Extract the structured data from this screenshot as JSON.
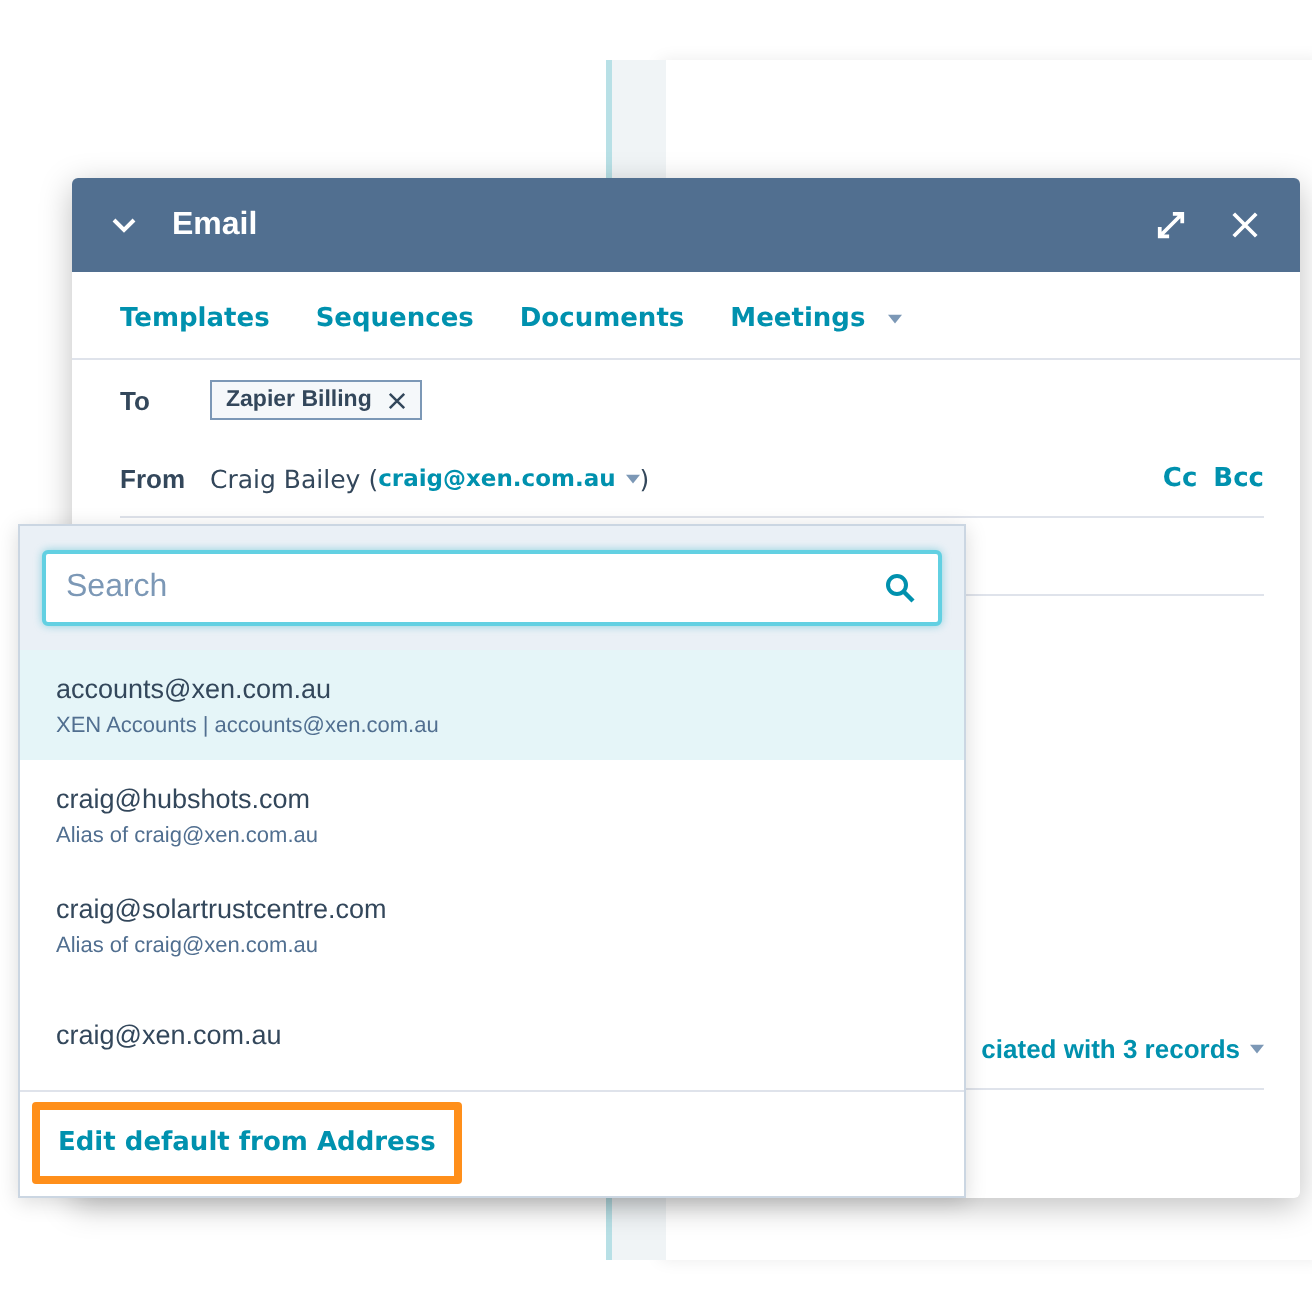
{
  "email": {
    "title": "Email",
    "tabs": [
      {
        "label": "Templates",
        "kind": "link"
      },
      {
        "label": "Sequences",
        "kind": "link"
      },
      {
        "label": "Documents",
        "kind": "link"
      },
      {
        "label": "Meetings",
        "kind": "menu"
      }
    ],
    "to": {
      "label": "To",
      "recipients": [
        {
          "name": "Zapier Billing"
        }
      ]
    },
    "from": {
      "label": "From",
      "name": "Craig Bailey",
      "open": "(",
      "address": "craig@xen.com.au",
      "close": ")"
    },
    "cc": "Cc",
    "bcc": "Bcc",
    "association": "ciated with 3 records"
  },
  "from_menu": {
    "search": {
      "placeholder": "Search"
    },
    "options": [
      {
        "address": "accounts@xen.com.au",
        "detail": "XEN Accounts | accounts@xen.com.au",
        "selected": true
      },
      {
        "address": "craig@hubshots.com",
        "detail": "Alias of craig@xen.com.au",
        "selected": false
      },
      {
        "address": "craig@solartrustcentre.com",
        "detail": "Alias of craig@xen.com.au",
        "selected": false
      },
      {
        "address": "craig@xen.com.au",
        "selected": false
      }
    ],
    "footer_link": {
      "label": "Edit default from Address",
      "highlighted": true
    }
  }
}
